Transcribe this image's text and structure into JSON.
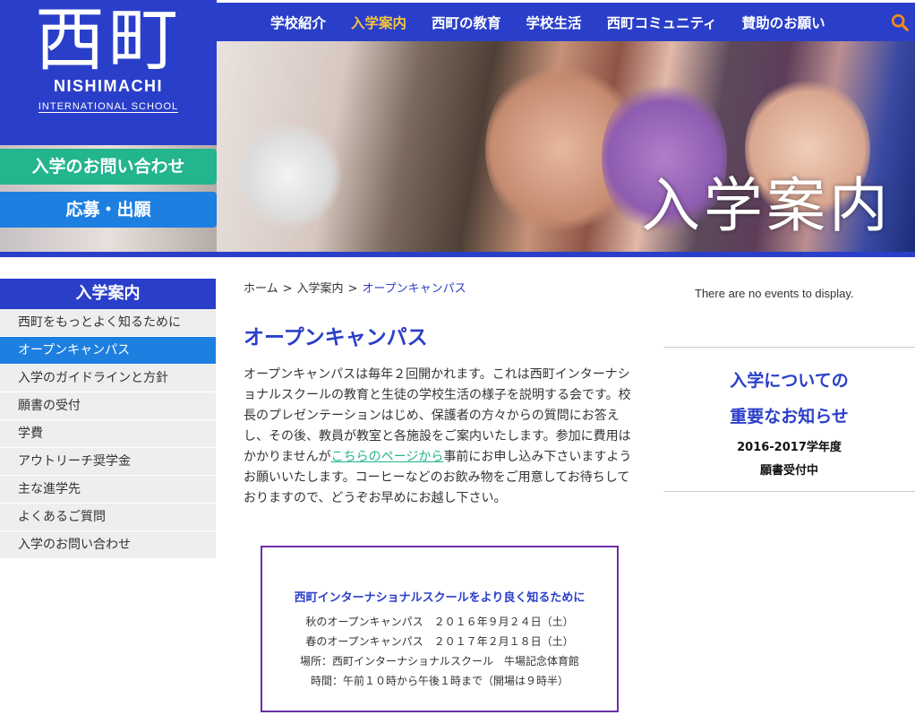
{
  "logo": {
    "kanji": "西町",
    "name_line1": "NISHIMACHI",
    "name_line2": "INTERNATIONAL SCHOOL"
  },
  "nav": {
    "items": [
      {
        "label": "学校紹介"
      },
      {
        "label": "入学案内"
      },
      {
        "label": "西町の教育"
      },
      {
        "label": "学校生活"
      },
      {
        "label": "西町コミュニティ"
      },
      {
        "label": "賛助のお願い"
      }
    ],
    "active": "入学案内",
    "search_icon": "search-icon"
  },
  "hero": {
    "title": "入学案内"
  },
  "cta": {
    "contact_label": "入学のお問い合わせ",
    "apply_label": "応募・出願"
  },
  "sidebar": {
    "title": "入学案内",
    "items": [
      {
        "label": "西町をもっとよく知るために"
      },
      {
        "label": "オープンキャンパス"
      },
      {
        "label": "入学のガイドラインと方針"
      },
      {
        "label": "願書の受付"
      },
      {
        "label": "学費"
      },
      {
        "label": "アウトリーチ奨学金"
      },
      {
        "label": "主な進学先"
      },
      {
        "label": "よくあるご質問"
      },
      {
        "label": "入学のお問い合わせ"
      }
    ],
    "active": "オープンキャンパス"
  },
  "breadcrumb": {
    "home": "ホーム",
    "separator": ">",
    "parent": "入学案内",
    "current": "オープンキャンパス"
  },
  "main": {
    "title": "オープンキャンパス",
    "paragraph_before_link": "オープンキャンパスは毎年２回開かれます。これは西町インターナショナルスクールの教育と生徒の学校生活の様子を説明する会です。校長のプレゼンテーションはじめ、保護者の方々からの質問にお答えし、その後、教員が教室と各施設をご案内いたします。参加に費用はかかりませんが",
    "link_text": "こちらのページから",
    "paragraph_after_link": "事前にお申し込み下さいますようお願いいたします。コーヒーなどのお飲み物をご用意してお待ちしておりますので、どうぞお早めにお越し下さい。"
  },
  "info_box": {
    "title": "西町インターナショナルスクールをより良く知るために",
    "lines": [
      "秋のオープンキャンパス　２０１６年９月２４日（土）",
      "春のオープンキャンパス　２０１７年２月１８日（土）",
      "場所：西町インターナショナルスクール　牛場記念体育館",
      "時間：午前１０時から午後１時まで（開場は９時半）"
    ]
  },
  "right_column": {
    "events_text": "There are no events to display.",
    "notice_line1": "入学についての",
    "notice_line2": "重要なお知らせ",
    "notice_line3": "2016-2017学年度",
    "notice_line4": "願書受付中"
  },
  "colors": {
    "brand_blue": "#2a3fc9",
    "active_nav": "#f5c43c",
    "cta_green": "#23b58d",
    "cta_blue": "#1d7fe0",
    "box_border": "#6a2fa6"
  }
}
